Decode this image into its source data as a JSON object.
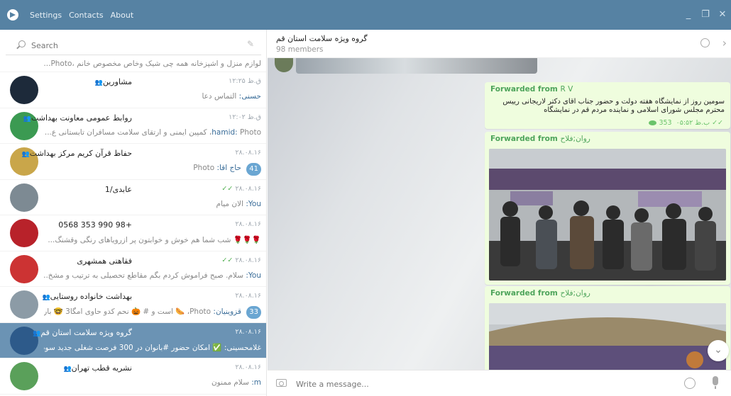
{
  "window": {
    "menu": [
      "Settings",
      "Contacts",
      "About"
    ],
    "controls": [
      "_",
      "❐",
      "✕"
    ]
  },
  "search": {
    "placeholder": "Search"
  },
  "chats": [
    {
      "preview": "لوازم منزل و اشپزخانه  همه چی شیک وخاص  مخصوص خانم ،Photo...",
      "partial": true
    },
    {
      "title": "مشاورین",
      "group": true,
      "time": "۱۲:۲۵ ق.ظ",
      "sender": "حسنی",
      "preview": "التماس دعا",
      "avatar_color": "#1d2a3a"
    },
    {
      "title": "روابط عمومی معاونت بهداشت",
      "group": true,
      "time": "۱۲:۰۲ ق.ظ",
      "sender": "hamid",
      "preview": "Photo، کمپین ایمنی و ارتقای سلامت مسافران تابستانی  ع...",
      "avatar_color": "#3b9a52"
    },
    {
      "title": "حفاظ قرآن کریم مرکز بهداشت",
      "group": true,
      "time": "۲۸.۰۸.۱۶",
      "sender": "حاج اقا",
      "preview": "Photo",
      "badge": "41",
      "avatar_color": "#c9a64a"
    },
    {
      "title": "عابدی/1",
      "group": false,
      "time": "۲۸.۰۸.۱۶",
      "ticks": true,
      "sender": "You",
      "preview": "الان میام",
      "avatar_color": "#7d8a93"
    },
    {
      "title": "+98 990 353 0568",
      "group": false,
      "time": "۲۸.۰۸.۱۶",
      "preview": "🌹🌹🌹 شب شما هم خوش و خوابتون پر ازرویاهای رنگی وقشنگ...",
      "avatar_color": "#b8222a"
    },
    {
      "title": "فقاهتی همشهری",
      "group": false,
      "time": "۲۸.۰۸.۱۶",
      "ticks": true,
      "sender": "You",
      "preview": "سلام. صبح فراموش کردم بگم مقاطع تحصیلی به ترتیب و مشخ...",
      "avatar_color": "#cc3333"
    },
    {
      "title": "بهداشت خانواده روستایی",
      "group": true,
      "time": "۲۸.۰۸.۱۶",
      "sender": "قزوینیان",
      "preview": "Photo، 🌭 است و # 🎃 نحم کدو حاوی امگا3 🤓 باردارکی...",
      "badge": "33",
      "avatar_color": "#8c9ba6"
    },
    {
      "title": "گروه ویژه سلامت استان قم",
      "group": true,
      "time": "۲۸.۰۸.۱۶",
      "sender": "غلامحسینی",
      "preview": "✅ امکان حضور #بانوان در 300 فرصت شغلی جدید سوم...",
      "active": true,
      "avatar_color": "#2d5a8a"
    },
    {
      "title": "نشریه قطب تهران",
      "group": true,
      "time": "۲۸.۰۸.۱۶",
      "sender": "m",
      "preview": "سلام ممنون",
      "avatar_color": "#5aa05a"
    }
  ],
  "header": {
    "title": "گروه ویژه سلامت استان قم",
    "members": "98 members"
  },
  "messages": [
    {
      "forwarded": "Forwarded from",
      "from": "R V",
      "text": "سومین روز از نمایشگاه هفته دولت و حضور جناب اقای دکتر لاریجانی رییس محترم مجلس شورای اسلامی و نماینده مردم قم در نمایشگاه",
      "views": "353",
      "time": "۰۵:۵۲ ب.ظ"
    },
    {
      "forwarded": "Forwarded from",
      "from": "روان;فلاح"
    },
    {
      "forwarded": "Forwarded from",
      "from": "روان;فلاح"
    }
  ],
  "composer": {
    "placeholder": "Write a message..."
  },
  "colors": {
    "titlebar": "#5682a3",
    "active": "#6b93b4",
    "bubble": "#effdde",
    "forward": "#4ea45b"
  }
}
